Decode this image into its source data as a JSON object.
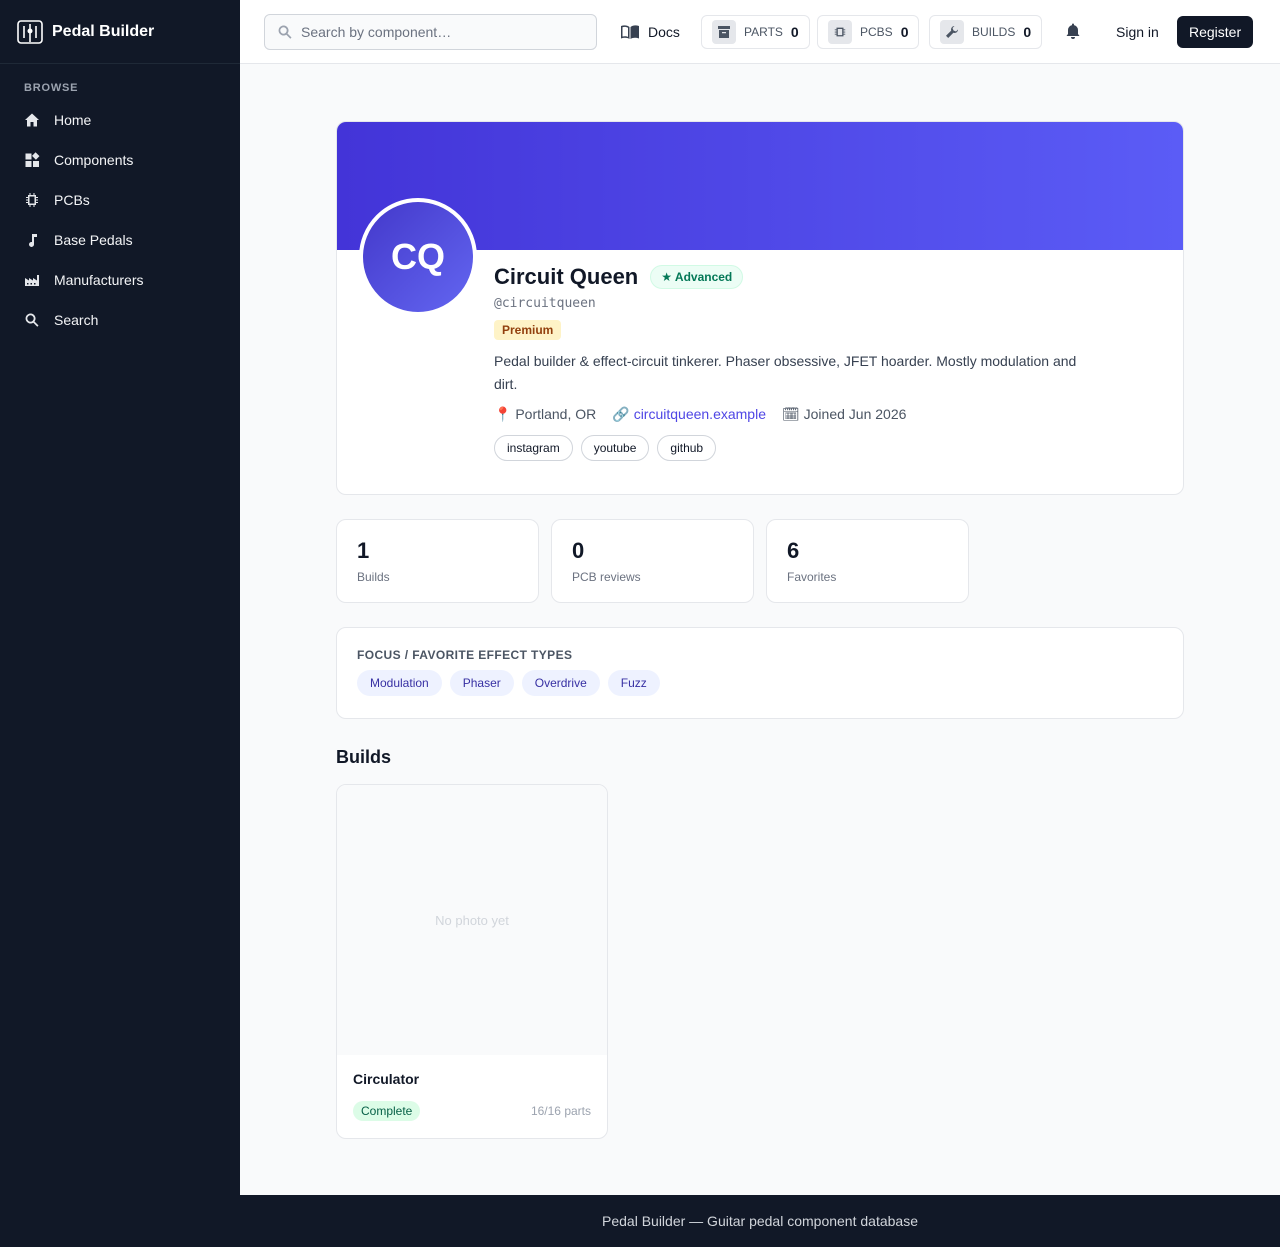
{
  "brand": {
    "name": "Pedal Builder",
    "icon": "pedal-logo-icon"
  },
  "sidebar": {
    "section": "BROWSE",
    "items": [
      {
        "label": "Home",
        "icon": "home-icon"
      },
      {
        "label": "Components",
        "icon": "grid-icon"
      },
      {
        "label": "PCBs",
        "icon": "chip-icon"
      },
      {
        "label": "Base Pedals",
        "icon": "music-note-icon"
      },
      {
        "label": "Manufacturers",
        "icon": "factory-icon"
      },
      {
        "label": "Search",
        "icon": "search-icon"
      }
    ]
  },
  "topbar": {
    "search_placeholder": "Search by component…",
    "docs_label": "Docs",
    "counters": [
      {
        "label": "PARTS",
        "value": "0",
        "icon": "box-icon"
      },
      {
        "label": "PCBS",
        "value": "0",
        "icon": "chip-icon"
      },
      {
        "label": "BUILDS",
        "value": "0",
        "icon": "wrench-icon"
      }
    ],
    "signin_label": "Sign in",
    "register_label": "Register"
  },
  "profile": {
    "initials": "CQ",
    "name": "Circuit Queen",
    "level": "★ Advanced",
    "handle": "@circuitqueen",
    "badge": "Premium",
    "bio": "Pedal builder & effect-circuit tinkerer. Phaser obsessive, JFET hoarder. Mostly modulation and dirt.",
    "location": "📍 Portland, OR",
    "website": "circuitqueen.example",
    "website_icon": "🔗",
    "joined": "🗓 Joined Jun 2026",
    "socials": [
      "instagram",
      "youtube",
      "github"
    ]
  },
  "stats": [
    {
      "value": "1",
      "label": "Builds"
    },
    {
      "value": "0",
      "label": "PCB reviews"
    },
    {
      "value": "6",
      "label": "Favorites"
    }
  ],
  "focus": {
    "title": "FOCUS / FAVORITE EFFECT TYPES",
    "tags": [
      "Modulation",
      "Phaser",
      "Overdrive",
      "Fuzz"
    ]
  },
  "builds": {
    "heading": "Builds",
    "items": [
      {
        "photo_placeholder": "No photo yet",
        "title": "Circulator",
        "status": "Complete",
        "parts": "16/16 parts"
      }
    ]
  },
  "footer": {
    "text": "Pedal Builder — Guitar pedal component database"
  }
}
